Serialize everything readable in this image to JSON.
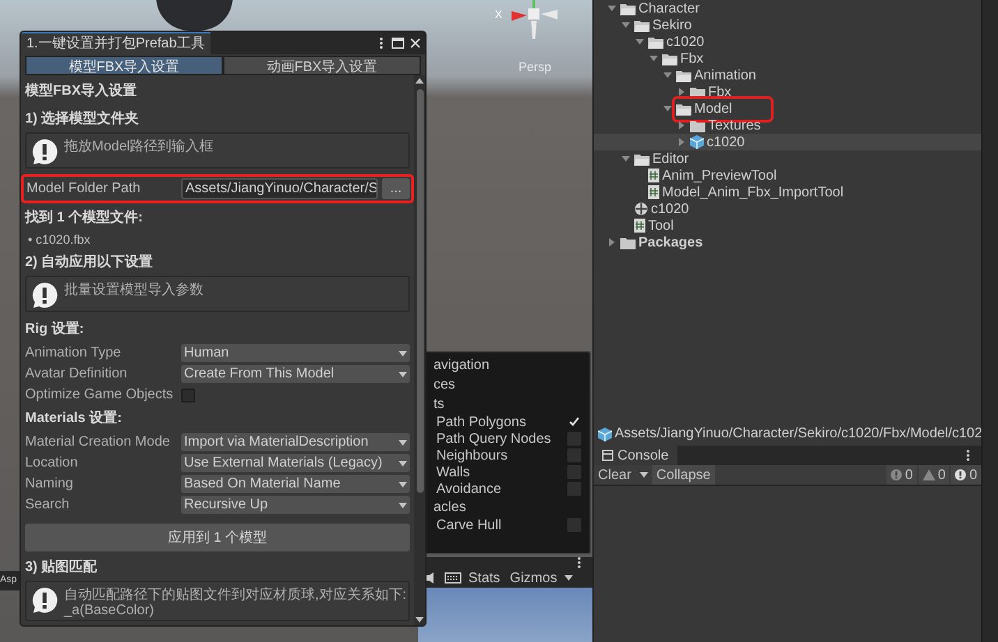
{
  "scene": {
    "axis_label": "X",
    "view_label": "Persp",
    "toolbar_text": "Asp"
  },
  "tool_window": {
    "title": "1.一键设置并打包Prefab工具",
    "tabs": [
      {
        "label": "模型FBX导入设置",
        "selected": true
      },
      {
        "label": "动画FBX导入设置",
        "selected": false
      }
    ],
    "content": [
      {
        "kind": "title",
        "text": "模型FBX导入设置"
      },
      {
        "kind": "section",
        "text": "1) 选择模型文件夹"
      },
      {
        "kind": "helpbox",
        "lines": [
          "拖放Model路径到输入框"
        ]
      },
      {
        "kind": "path",
        "label": "Model Folder Path",
        "value": "Assets/JiangYinuo/Character/S",
        "button": "...",
        "highlighted": true
      },
      {
        "kind": "section",
        "text": "找到 1 个模型文件:"
      },
      {
        "kind": "bullet",
        "marker": "•",
        "text": "c1020.fbx"
      },
      {
        "kind": "section",
        "text": "2) 自动应用以下设置"
      },
      {
        "kind": "helpbox",
        "lines": [
          "批量设置模型导入参数"
        ]
      },
      {
        "kind": "section",
        "text": "Rig 设置:"
      },
      {
        "kind": "dropdown",
        "label": "Animation Type",
        "value": "Human"
      },
      {
        "kind": "dropdown",
        "label": "Avatar Definition",
        "value": "Create From This Model"
      },
      {
        "kind": "checkbox",
        "label": "Optimize Game Objects",
        "checked": false
      },
      {
        "kind": "section",
        "text": "Materials 设置:"
      },
      {
        "kind": "dropdown",
        "label": "Material Creation Mode",
        "value": "Import via MaterialDescription"
      },
      {
        "kind": "dropdown",
        "label": "Location",
        "value": "Use External Materials (Legacy)"
      },
      {
        "kind": "dropdown",
        "label": "Naming",
        "value": "Based On Material Name"
      },
      {
        "kind": "dropdown",
        "label": "Search",
        "value": "Recursive Up"
      },
      {
        "kind": "button",
        "text": "应用到 1 个模型"
      },
      {
        "kind": "section",
        "text": "3) 贴图匹配"
      },
      {
        "kind": "helpbox",
        "lines": [
          "自动匹配路径下的贴图文件到对应材质球,对应关系如下:",
          "_a(BaseColor)"
        ]
      }
    ]
  },
  "navigation_overlay": {
    "items": [
      {
        "kind": "heading",
        "label": "avigation"
      },
      {
        "kind": "heading",
        "label": "ces"
      },
      {
        "kind": "heading",
        "label": "ts"
      },
      {
        "kind": "toggle",
        "label": "Path Polygons",
        "checked": true
      },
      {
        "kind": "toggle",
        "label": "Path Query Nodes",
        "checked": false
      },
      {
        "kind": "toggle",
        "label": "Neighbours",
        "checked": false
      },
      {
        "kind": "toggle",
        "label": "Walls",
        "checked": false
      },
      {
        "kind": "toggle",
        "label": "Avoidance",
        "checked": false
      },
      {
        "kind": "heading",
        "label": "acles"
      },
      {
        "kind": "toggle",
        "label": "Carve Hull",
        "checked": false
      }
    ]
  },
  "game_toolbar": {
    "stats": "Stats",
    "gizmos": "Gizmos"
  },
  "project_tree": [
    {
      "label": "Character",
      "kind": "folder",
      "expanded": true,
      "selected": false,
      "highlighted": false,
      "children": [
        {
          "label": "Sekiro",
          "kind": "folder",
          "expanded": true,
          "selected": false,
          "highlighted": false,
          "children": [
            {
              "label": "c1020",
              "kind": "folder",
              "expanded": true,
              "selected": false,
              "highlighted": false,
              "children": [
                {
                  "label": "Fbx",
                  "kind": "folder",
                  "expanded": true,
                  "selected": false,
                  "highlighted": false,
                  "children": [
                    {
                      "label": "Animation",
                      "kind": "folder",
                      "expanded": true,
                      "selected": false,
                      "highlighted": false,
                      "children": [
                        {
                          "label": "Fbx",
                          "kind": "folder",
                          "expanded": false,
                          "selected": false,
                          "highlighted": false
                        }
                      ]
                    },
                    {
                      "label": "Model",
                      "kind": "folder",
                      "expanded": true,
                      "selected": false,
                      "highlighted": true,
                      "children": [
                        {
                          "label": "Textures",
                          "kind": "folder",
                          "expanded": false,
                          "selected": false,
                          "highlighted": false
                        },
                        {
                          "label": "c1020",
                          "kind": "model",
                          "expanded": false,
                          "selected": true,
                          "highlighted": false
                        }
                      ]
                    }
                  ]
                }
              ]
            }
          ]
        },
        {
          "label": "Editor",
          "kind": "folder",
          "expanded": true,
          "selected": false,
          "highlighted": false,
          "children": [
            {
              "label": "Anim_PreviewTool",
              "kind": "script",
              "selected": false,
              "highlighted": false
            },
            {
              "label": "Model_Anim_Fbx_ImportTool",
              "kind": "script",
              "selected": false,
              "highlighted": false
            }
          ]
        },
        {
          "label": "c1020",
          "kind": "prefab",
          "selected": false,
          "highlighted": false
        },
        {
          "label": "Tool",
          "kind": "script",
          "selected": false,
          "highlighted": false
        }
      ]
    },
    {
      "label": "Packages",
      "kind": "folder",
      "expanded": false,
      "selected": false,
      "highlighted": false
    }
  ],
  "path_bar": {
    "text": "Assets/JiangYinuo/Character/Sekiro/c1020/Fbx/Model/c102"
  },
  "console": {
    "tab": "Console",
    "clear": "Clear",
    "collapse": "Collapse",
    "counters": [
      {
        "kind": "info",
        "count": "0"
      },
      {
        "kind": "warning",
        "count": "0"
      },
      {
        "kind": "error",
        "count": "0"
      }
    ]
  }
}
